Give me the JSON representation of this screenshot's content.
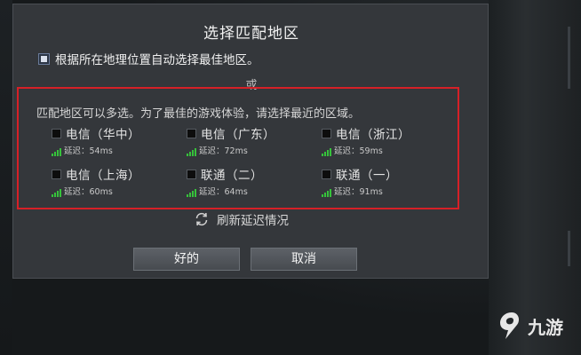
{
  "dialog": {
    "title": "选择匹配地区",
    "auto_select_label": "根据所在地理位置自动选择最佳地区。",
    "or_label": "或",
    "region_description": "匹配地区可以多选。为了最佳的游戏体验，请选择最近的区域。",
    "regions": [
      {
        "name": "电信（华中）",
        "latency": "延迟：54ms",
        "checked": false
      },
      {
        "name": "电信（广东）",
        "latency": "延迟：72ms",
        "checked": false
      },
      {
        "name": "电信（浙江）",
        "latency": "延迟：59ms",
        "checked": false
      },
      {
        "name": "电信（上海）",
        "latency": "延迟：60ms",
        "checked": false
      },
      {
        "name": "联通（二）",
        "latency": "延迟：64ms",
        "checked": false
      },
      {
        "name": "联通（一）",
        "latency": "延迟：91ms",
        "checked": false
      }
    ],
    "refresh_label": "刷新延迟情况",
    "ok_label": "好的",
    "cancel_label": "取消"
  },
  "watermark": {
    "text": "九游",
    "icon": "jiuyou-logo-icon"
  },
  "colors": {
    "highlight_border": "#d62027",
    "signal_green": "#36c23b",
    "dialog_bg": "#34373b"
  }
}
